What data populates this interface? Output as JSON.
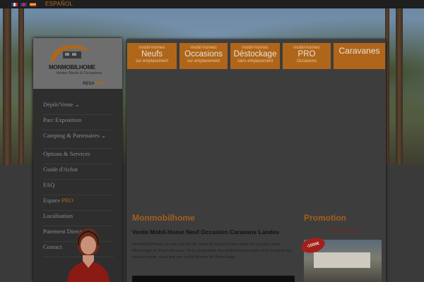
{
  "topbar": {
    "languages": [
      "fr-flag-icon",
      "uk-flag-icon",
      "es-flag-icon"
    ],
    "language_label": "ESPAÑOL"
  },
  "logo": {
    "name": "MONMOBILHOME",
    "tagline": "Ventes Neufs & Occasions",
    "resa_prefix": "RESA",
    "resa_suffix": "SUD"
  },
  "sidebar": {
    "items": [
      {
        "label": "Dépôt/Vente ⌄"
      },
      {
        "label": "Parc Exposition"
      },
      {
        "label": "Camping & Partenaires ⌄"
      },
      {
        "label": "Options & Services"
      },
      {
        "label": "Guide d'Achat"
      },
      {
        "label": "FAQ"
      },
      {
        "label": "Espace",
        "highlight": "PRO"
      },
      {
        "label": "Localisation"
      },
      {
        "label": "Paiement Direct"
      },
      {
        "label": "Contact"
      }
    ]
  },
  "tabs": [
    {
      "top": "mobil-homes",
      "main": "Neufs",
      "bottom": "sur emplacement"
    },
    {
      "top": "mobil-homes",
      "main": "Occasions",
      "bottom": "sur emplacement"
    },
    {
      "top": "mobil-homes",
      "main": "Déstockage",
      "bottom": "sans emplacement"
    },
    {
      "top": "mobil-homes",
      "main": "PRO",
      "bottom": "Occasions"
    },
    {
      "top": "",
      "main": "Caravanes",
      "bottom": ""
    }
  ],
  "main": {
    "title": "Monmobilhome",
    "subtitle": "Vente Mobil-Home Neuf Occasion Caravane Landes",
    "paragraph": "MonMobilHome est une société de vente de mobil-homes dans les Landes, entre Messanges et Vieux-Boucau. Nous proposons des mobil-homes neufs et d'occasion sur emplacement, ainsi que des mobil-homes de déstockage."
  },
  "promo": {
    "title": "Promotion",
    "subtitle": "Prix en baisse",
    "badge": "-1000€"
  },
  "colors": {
    "accent": "#b0661a",
    "accent_text": "#a45f1a",
    "promo_red": "#8a1a12"
  }
}
